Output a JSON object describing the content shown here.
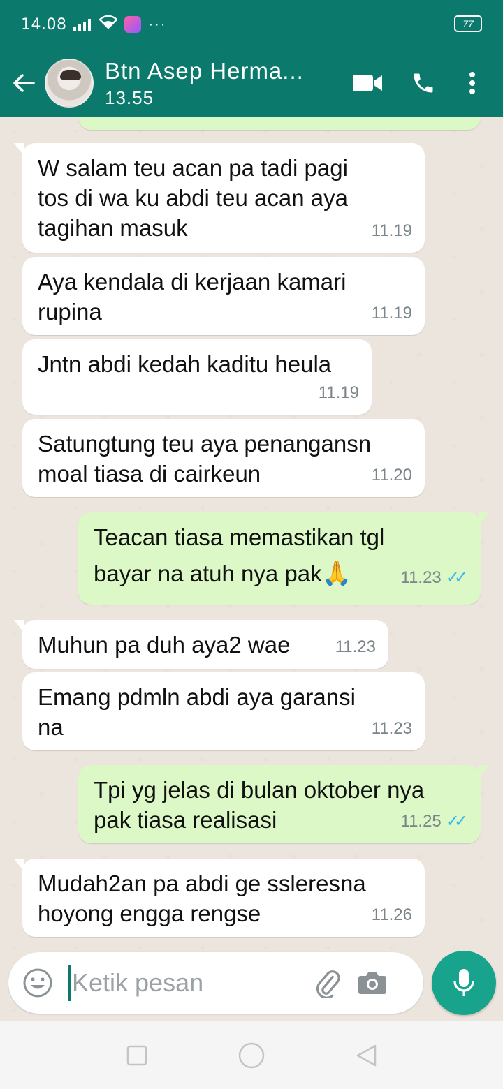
{
  "status_bar": {
    "time": "14.08",
    "battery": "77"
  },
  "header": {
    "contact_name": "Btn Asep Herma...",
    "contact_status": "13.55"
  },
  "messages": [
    {
      "direction": "in",
      "text": "W salam teu acan pa tadi pagi\ntos di wa ku abdi teu acan  aya\ntagihan masuk",
      "time": "11.19"
    },
    {
      "direction": "in",
      "text": "Aya kendala di kerjaan kamari\nrupina",
      "time": "11.19"
    },
    {
      "direction": "in",
      "text": "Jntn abdi kedah kaditu heula",
      "time": "11.19"
    },
    {
      "direction": "in",
      "text": "Satungtung teu aya penangansn\nmoal tiasa di cairkeun",
      "time": "11.20"
    },
    {
      "direction": "out",
      "text": "Teacan tiasa memastikan tgl\nbayar na atuh nya pak",
      "emoji": "🙏",
      "time": "11.23",
      "status": "read"
    },
    {
      "direction": "in",
      "text": "Muhun pa duh aya2 wae",
      "time": "11.23"
    },
    {
      "direction": "in",
      "text": "Emang pdmln abdi aya garansi\nna",
      "time": "11.23"
    },
    {
      "direction": "out",
      "text": "Tpi yg jelas di bulan oktober nya\npak tiasa realisasi",
      "time": "11.25",
      "status": "read"
    },
    {
      "direction": "in",
      "text": "Mudah2an pa abdi ge ssleresna\nhoyong engga rengse",
      "time": "11.26"
    }
  ],
  "composer": {
    "placeholder": "Ketik pesan"
  },
  "icons": {
    "back": "arrow-left-icon",
    "video": "video-call-icon",
    "call": "phone-icon",
    "menu": "more-vertical-icon",
    "emoji": "emoji-icon",
    "attach": "paperclip-icon",
    "camera": "camera-icon",
    "mic": "microphone-icon"
  },
  "colors": {
    "header": "#0b7a6c",
    "outgoing_bubble": "#dcf8c6",
    "incoming_bubble": "#ffffff",
    "read_ticks": "#34b7f1",
    "mic_button": "#18a48c"
  }
}
